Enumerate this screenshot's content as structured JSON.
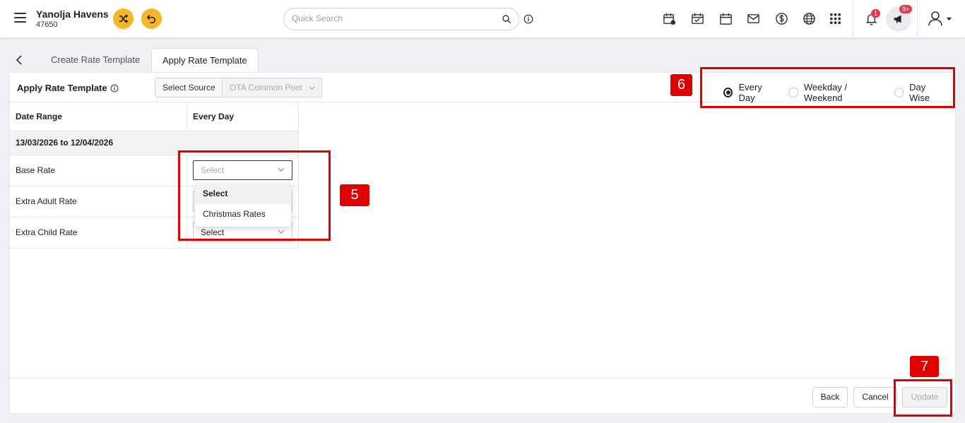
{
  "header": {
    "property_name": "Yanolja Havens",
    "property_id": "47650",
    "search_placeholder": "Quick Search",
    "notification_count": "1",
    "announcement_count": "9+"
  },
  "tabs": [
    {
      "label": "Create Rate Template"
    },
    {
      "label": "Apply Rate Template"
    }
  ],
  "panel": {
    "title": "Apply Rate Template",
    "source_label": "Select Source",
    "source_value": "OTA Common Pool",
    "radio_options": [
      {
        "label": "Every Day",
        "checked": true
      },
      {
        "label": "Weekday / Weekend",
        "checked": false
      },
      {
        "label": "Day Wise",
        "checked": false
      }
    ]
  },
  "table": {
    "col_headers": [
      "Date Range",
      "Every Day"
    ],
    "group_label": "13/03/2026 to 12/04/2026",
    "rows": [
      {
        "label": "Base Rate",
        "value": "Select"
      },
      {
        "label": "Extra Adult Rate",
        "value": ""
      },
      {
        "label": "Extra Child Rate",
        "value": "Select"
      }
    ]
  },
  "dropdown": {
    "options": [
      "Select",
      "Christmas Rates"
    ]
  },
  "footer": {
    "back_label": "Back",
    "cancel_label": "Cancel",
    "update_label": "Update"
  },
  "annotations": [
    "5",
    "6",
    "7"
  ],
  "colors": {
    "accent_yellow": "#f5b629",
    "annotation_red": "#e00000",
    "badge_red": "#e8384f"
  }
}
